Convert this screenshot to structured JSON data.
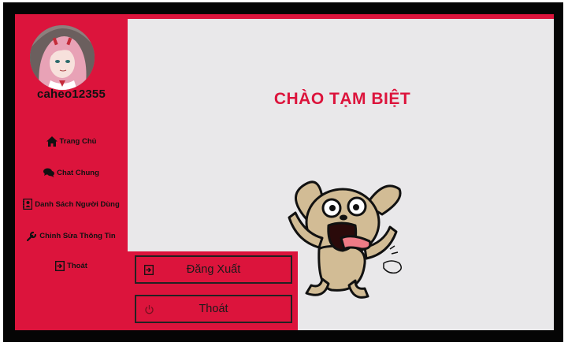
{
  "user": {
    "username": "caheo12355"
  },
  "sidebar": {
    "items": [
      {
        "label": "Trang Chủ",
        "icon": "home-icon"
      },
      {
        "label": "Chat Chung",
        "icon": "chat-icon"
      },
      {
        "label": "Danh Sách Người Dùng",
        "icon": "contacts-icon"
      },
      {
        "label": "Chỉnh Sửa Thông Tin",
        "icon": "wrench-icon"
      },
      {
        "label": "Thoát",
        "icon": "exit-icon"
      }
    ]
  },
  "main": {
    "title": "CHÀO TẠM BIỆT",
    "buttons": [
      {
        "label": "Đăng Xuất",
        "icon": "logout-icon"
      },
      {
        "label": "Thoát",
        "icon": "power-icon"
      }
    ]
  },
  "colors": {
    "accent": "#dc143c",
    "background": "#e9e8ea",
    "frame": "#050505"
  }
}
